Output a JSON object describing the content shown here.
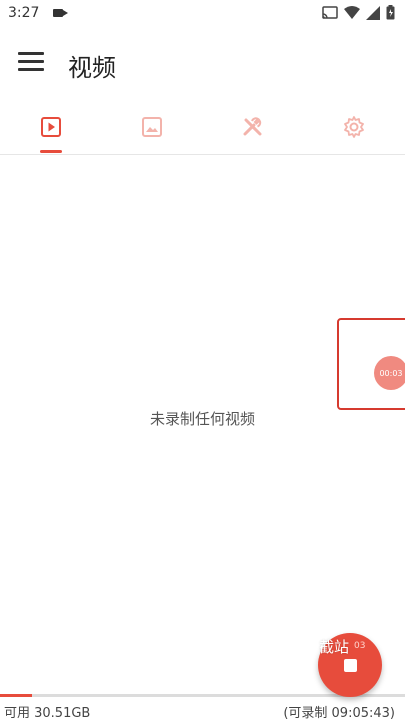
{
  "status_bar": {
    "time": "3:27",
    "icons": [
      "videocam-icon",
      "cast-icon",
      "wifi-icon",
      "signal-icon",
      "battery-icon"
    ]
  },
  "app_bar": {
    "title": "视频",
    "menu_icon": "menu-icon"
  },
  "tabs": [
    {
      "icon": "video-play-icon",
      "selected": true
    },
    {
      "icon": "image-icon",
      "selected": false
    },
    {
      "icon": "tools-icon",
      "selected": false
    },
    {
      "icon": "settings-icon",
      "selected": false
    }
  ],
  "content": {
    "empty_message": "未录制任何视频"
  },
  "floating_overlay": {
    "timer": "00:03"
  },
  "fab": {
    "label": "截站",
    "small_text": "03",
    "icon": "stop-icon"
  },
  "footer": {
    "storage_available": "可用 30.51GB",
    "record_time_available": "(可录制 09:05:43)",
    "storage_used_fraction": 0.08
  },
  "colors": {
    "accent": "#e74c3c",
    "inactive_icon": "#f3b3ab"
  }
}
